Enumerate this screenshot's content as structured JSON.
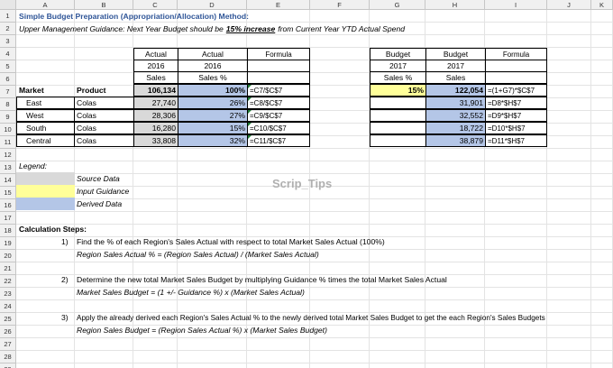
{
  "columns": [
    "A",
    "B",
    "C",
    "D",
    "E",
    "F",
    "G",
    "H",
    "I",
    "J",
    "K"
  ],
  "rows": [
    "1",
    "2",
    "3",
    "4",
    "5",
    "6",
    "7",
    "8",
    "9",
    "10",
    "11",
    "12",
    "13",
    "14",
    "15",
    "16",
    "17",
    "18",
    "19",
    "20",
    "21",
    "22",
    "23",
    "24",
    "25",
    "26",
    "27",
    "28",
    "29"
  ],
  "title": "Simple Budget Preparation (Appropriation/Allocation) Method:",
  "guidance": {
    "prefix": "Upper Management Guidance: Next Year Budget should be ",
    "highlight": "15% increase",
    "suffix": " from Current Year YTD Actual Spend"
  },
  "actual_table": {
    "h1": [
      "Actual",
      "Actual",
      "Formula"
    ],
    "h2": [
      "2016",
      "2016",
      ""
    ],
    "h3": [
      "Sales",
      "Sales %",
      ""
    ],
    "col_market": "Market",
    "col_product": "Product",
    "rows": [
      {
        "market": "Market",
        "product": "Colas",
        "sales": "106,134",
        "pct": "100%",
        "formula": "=C7/$C$7"
      },
      {
        "market": "East",
        "product": "Colas",
        "sales": "27,740",
        "pct": "26%",
        "formula": "=C8/$C$7"
      },
      {
        "market": "West",
        "product": "Colas",
        "sales": "28,306",
        "pct": "27%",
        "formula": "=C9/$C$7"
      },
      {
        "market": "South",
        "product": "Colas",
        "sales": "16,280",
        "pct": "15%",
        "formula": "=C10/$C$7"
      },
      {
        "market": "Central",
        "product": "Colas",
        "sales": "33,808",
        "pct": "32%",
        "formula": "=C11/$C$7"
      }
    ]
  },
  "budget_table": {
    "h1": [
      "Budget",
      "Budget",
      "Formula"
    ],
    "h2": [
      "2017",
      "2017",
      ""
    ],
    "h3": [
      "Sales %",
      "Sales",
      ""
    ],
    "rows": [
      {
        "pct": "15%",
        "sales": "122,054",
        "formula": "=(1+G7)*$C$7"
      },
      {
        "pct": "",
        "sales": "31,901",
        "formula": "=D8*$H$7"
      },
      {
        "pct": "",
        "sales": "32,552",
        "formula": "=D9*$H$7"
      },
      {
        "pct": "",
        "sales": "18,722",
        "formula": "=D10*$H$7"
      },
      {
        "pct": "",
        "sales": "38,879",
        "formula": "=D11*$H$7"
      }
    ]
  },
  "legend": {
    "title": "Legend:",
    "items": [
      "Source Data",
      "Input Guidance",
      "Derived Data"
    ],
    "colors": [
      "#d9d9d9",
      "#ffff99",
      "#b4c6e7"
    ]
  },
  "watermark": "Scrip_Tips",
  "steps": {
    "title": "Calculation Steps:",
    "items": [
      {
        "num": "1)",
        "text": "Find the %  of each Region's Sales Actual with respect to total Market Sales Actual (100%)",
        "formula": "Region Sales Actual % = (Region Sales Actual) / (Market Sales Actual)"
      },
      {
        "num": "2)",
        "text": "Determine the new total Market Sales Budget by multiplying Guidance % times the total Market Sales Actual",
        "formula": "Market Sales Budget = (1 +/- Guidance %) x (Market Sales Actual)"
      },
      {
        "num": "3)",
        "text": "Apply the already derived each Region's Sales Actual % to the newly derived total Market Sales Budget to get the each Region's Sales Budgets",
        "formula": "Region Sales Budget = (Region Sales Actual %) x (Market Sales Budget)"
      }
    ]
  }
}
